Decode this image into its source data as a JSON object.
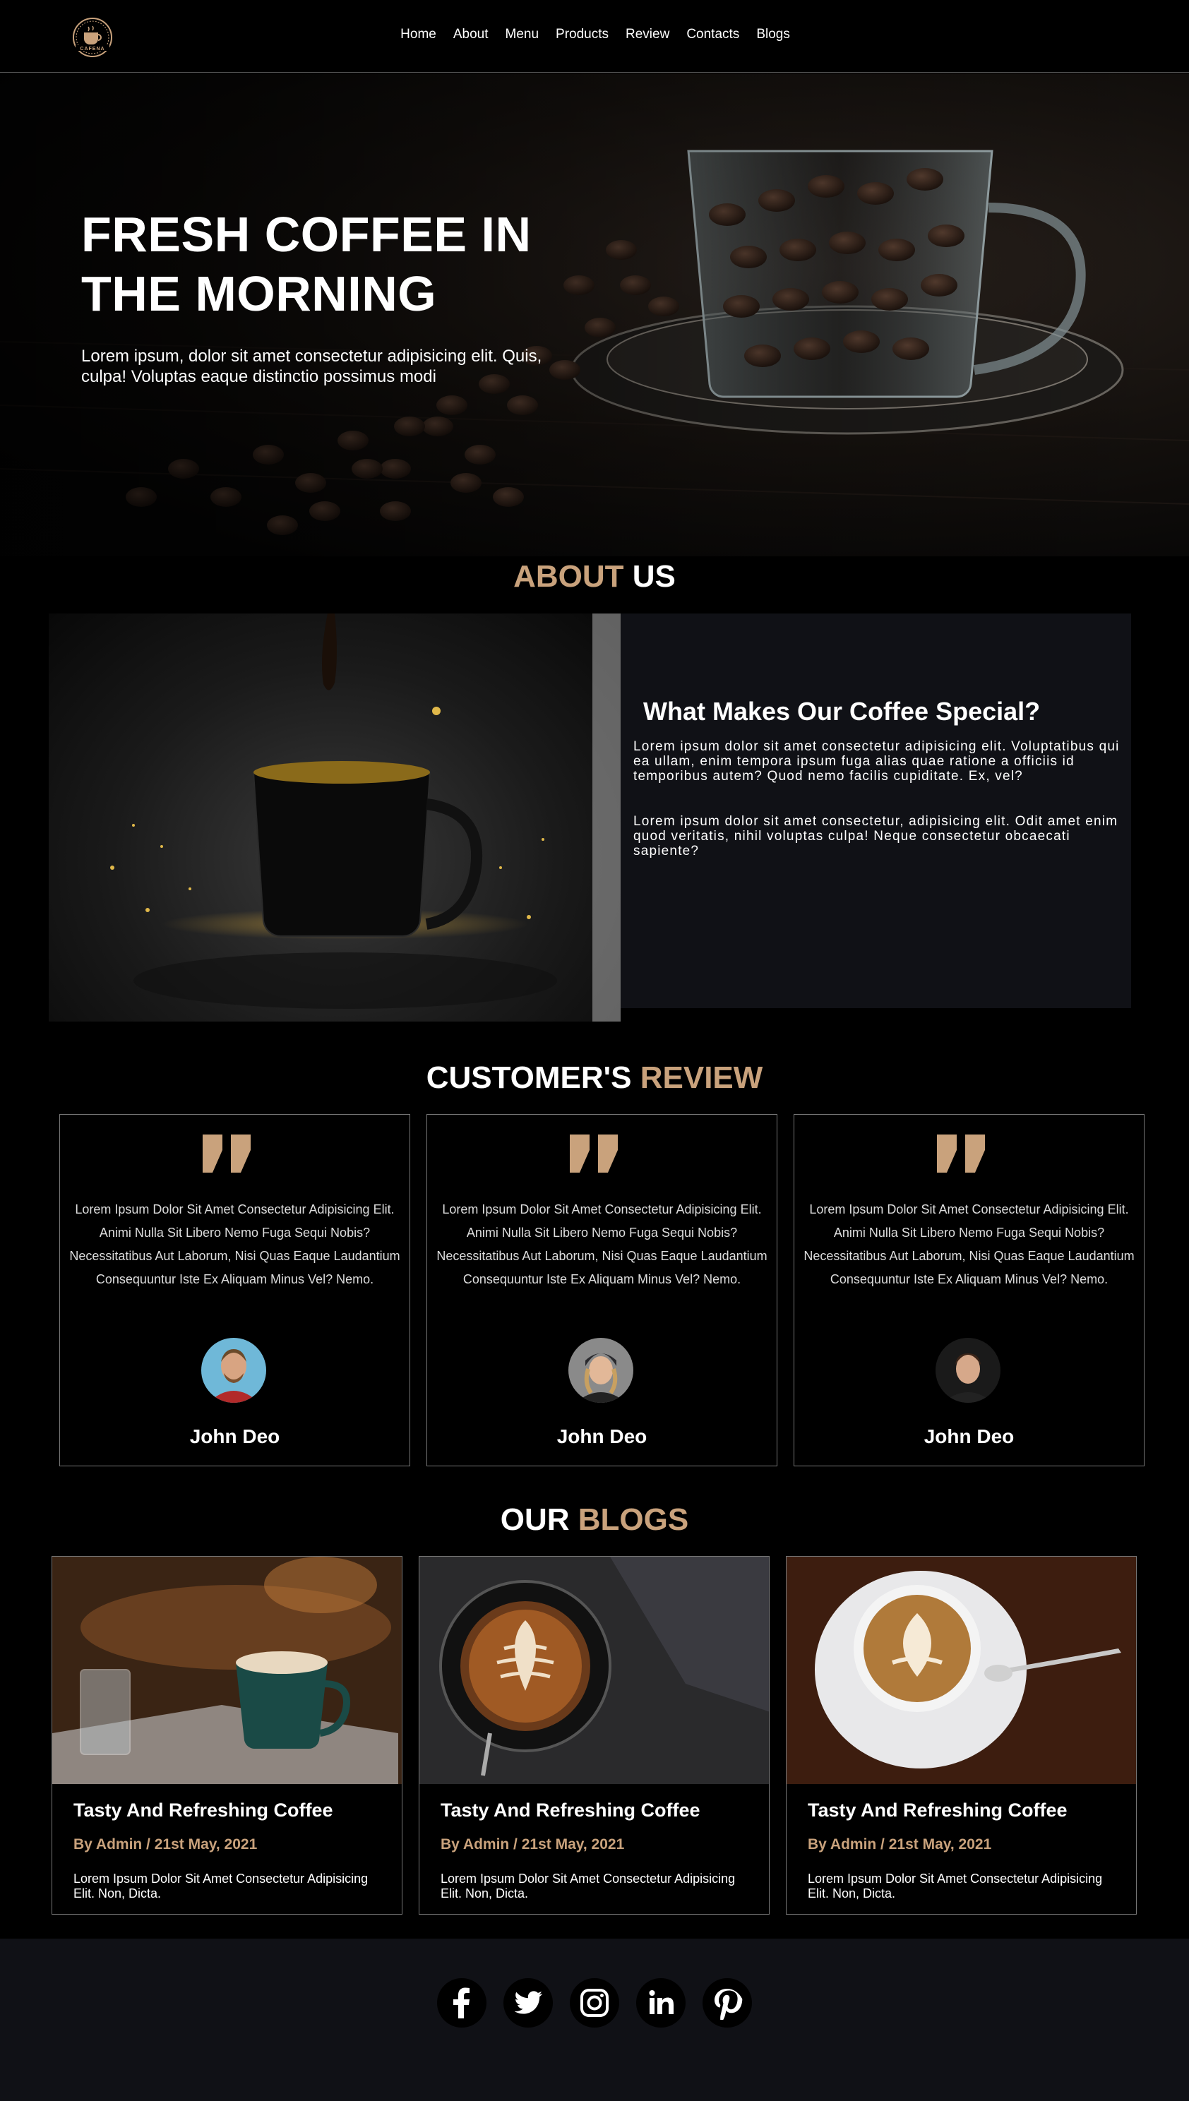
{
  "nav": {
    "logo_text": "CAFENA",
    "links": [
      "Home",
      "About",
      "Menu",
      "Products",
      "Review",
      "Contacts",
      "Blogs"
    ]
  },
  "hero": {
    "title": "FRESH COFFEE IN THE MORNING",
    "subtitle": "Lorem ipsum, dolor sit amet consectetur adipisicing elit. Quis, culpa! Voluptas eaque distinctio possimus modi"
  },
  "about": {
    "title_accent": "ABOUT",
    "title_rest": "US",
    "heading": "What Makes Our Coffee Special?",
    "para1": "Lorem ipsum dolor sit amet consectetur adipisicing elit. Voluptatibus qui ea ullam, enim tempora ipsum fuga alias quae ratione a officiis id temporibus autem? Quod nemo facilis cupiditate. Ex, vel?",
    "para2": "Lorem ipsum dolor sit amet consectetur, adipisicing elit. Odit amet enim quod veritatis, nihil voluptas culpa! Neque consectetur obcaecati sapiente?"
  },
  "reviews": {
    "title_rest": "CUSTOMER'S",
    "title_accent": "REVIEW",
    "items": [
      {
        "text": "Lorem Ipsum Dolor Sit Amet Consectetur Adipisicing Elit. Animi Nulla Sit Libero Nemo Fuga Sequi Nobis? Necessitatibus Aut Laborum, Nisi Quas Eaque Laudantium Consequuntur Iste Ex Aliquam Minus Vel? Nemo.",
        "name": "John Deo"
      },
      {
        "text": "Lorem Ipsum Dolor Sit Amet Consectetur Adipisicing Elit. Animi Nulla Sit Libero Nemo Fuga Sequi Nobis? Necessitatibus Aut Laborum, Nisi Quas Eaque Laudantium Consequuntur Iste Ex Aliquam Minus Vel? Nemo.",
        "name": "John Deo"
      },
      {
        "text": "Lorem Ipsum Dolor Sit Amet Consectetur Adipisicing Elit. Animi Nulla Sit Libero Nemo Fuga Sequi Nobis? Necessitatibus Aut Laborum, Nisi Quas Eaque Laudantium Consequuntur Iste Ex Aliquam Minus Vel? Nemo.",
        "name": "John Deo"
      }
    ]
  },
  "blogs": {
    "title_rest": "OUR",
    "title_accent": "BLOGS",
    "items": [
      {
        "title": "Tasty And Refreshing Coffee",
        "meta": "By Admin / 21st May, 2021",
        "text": "Lorem Ipsum Dolor Sit Amet Consectetur Adipisicing Elit. Non, Dicta."
      },
      {
        "title": "Tasty And Refreshing Coffee",
        "meta": "By Admin / 21st May, 2021",
        "text": "Lorem Ipsum Dolor Sit Amet Consectetur Adipisicing Elit. Non, Dicta."
      },
      {
        "title": "Tasty And Refreshing Coffee",
        "meta": "By Admin / 21st May, 2021",
        "text": "Lorem Ipsum Dolor Sit Amet Consectetur Adipisicing Elit. Non, Dicta."
      }
    ]
  },
  "footer": {
    "socials": [
      "facebook-icon",
      "twitter-icon",
      "instagram-icon",
      "linkedin-icon",
      "pinterest-icon"
    ]
  },
  "colors": {
    "accent": "#c9a27c",
    "background": "#000000",
    "panel": "#101116"
  }
}
